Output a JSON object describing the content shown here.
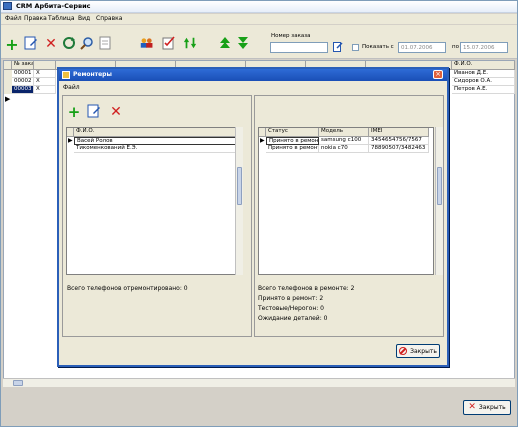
{
  "window": {
    "title": "CRM Арбита-Сервис"
  },
  "menu": [
    "Файл",
    "Правка",
    "Таблица",
    "Вид",
    "Справка"
  ],
  "toolbar": {
    "order_number_label": "Номер заказа",
    "order_number_value": "",
    "show_from_label": "Показать с",
    "date_from": "01.07.2006",
    "po_label": "по",
    "date_to": "15.07.2006",
    "icons": [
      "add-icon",
      "edit-icon",
      "delete-icon",
      "refresh-icon",
      "search-icon",
      "document-icon",
      "users-icon",
      "checklist-icon",
      "sort-icon",
      "up-icon",
      "down-icon"
    ]
  },
  "main_grid": {
    "headers": [
      "№ заказа",
      "",
      "",
      "",
      "",
      "",
      "",
      "",
      "Ф.И.О."
    ],
    "rows": [
      {
        "order": "00001",
        "mark": "X",
        "fio": "Иванов Д.Е."
      },
      {
        "order": "00002",
        "mark": "X",
        "fio": "Сидоров О.А."
      },
      {
        "order": "00003",
        "mark": "X",
        "fio": "Петров А.Е."
      }
    ]
  },
  "dialog": {
    "title": "Ремонтеры",
    "menu": "Файл",
    "left_grid": {
      "header": "Ф.И.О.",
      "rows": [
        "Васей Ролов",
        "Тикоменкований Е.Э."
      ]
    },
    "left_stat": "Всего телефонов отремонтировано: 0",
    "right_grid": {
      "headers": [
        "Статус",
        "Модель",
        "IMEI"
      ],
      "rows": [
        {
          "status": "Принято в ремонт",
          "model": "samsung c100",
          "imei": "3454654756/7567"
        },
        {
          "status": "Принято в ремонт",
          "model": "nokia c70",
          "imei": "78890507/3482463"
        }
      ]
    },
    "right_stats": [
      "Всего телефонов в ремонте: 2",
      "Принято в ремонт: 2",
      "Тестовые/Нерогон: 0",
      "Ожидание деталей: 0"
    ],
    "close_label": "Закрыть"
  },
  "footer": {
    "close_label": "Закрыть"
  }
}
